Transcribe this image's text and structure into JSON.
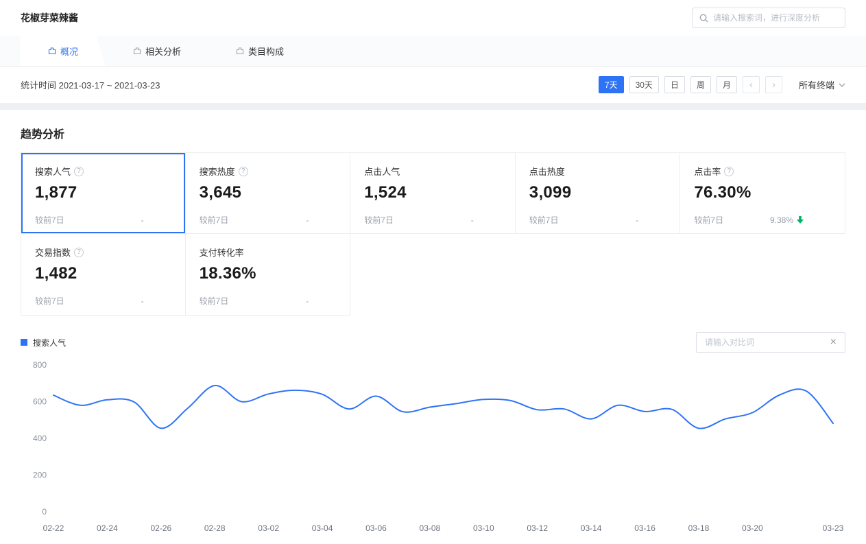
{
  "header": {
    "title": "花椒芽菜辣酱",
    "search": {
      "placeholder": "请输入搜索词，进行深度分析"
    }
  },
  "tabs": [
    {
      "id": "overview",
      "label": "概况",
      "active": true
    },
    {
      "id": "related-analysis",
      "label": "相关分析",
      "active": false
    },
    {
      "id": "category-composition",
      "label": "类目构成",
      "active": false
    }
  ],
  "filter_bar": {
    "stat_time": "统计时间 2021-03-17 ~ 2021-03-23",
    "range_buttons": [
      {
        "id": "7d",
        "label": "7天",
        "active": true
      },
      {
        "id": "30d",
        "label": "30天",
        "active": false
      },
      {
        "id": "day",
        "label": "日",
        "active": false
      },
      {
        "id": "week",
        "label": "周",
        "active": false
      },
      {
        "id": "month",
        "label": "月",
        "active": false
      }
    ],
    "terminal": "所有终端"
  },
  "trend_section": {
    "title": "趋势分析",
    "metrics": [
      {
        "id": "search-popularity",
        "label": "搜索人气",
        "info": true,
        "value": "1,877",
        "compare_label": "较前7日",
        "compare_value": "-",
        "selected": true,
        "trend": null
      },
      {
        "id": "search-heat",
        "label": "搜索热度",
        "info": true,
        "value": "3,645",
        "compare_label": "较前7日",
        "compare_value": "-",
        "selected": false,
        "trend": null
      },
      {
        "id": "click-popularity",
        "label": "点击人气",
        "info": false,
        "value": "1,524",
        "compare_label": "较前7日",
        "compare_value": "-",
        "selected": false,
        "trend": null
      },
      {
        "id": "click-heat",
        "label": "点击热度",
        "info": false,
        "value": "3,099",
        "compare_label": "较前7日",
        "compare_value": "-",
        "selected": false,
        "trend": null
      },
      {
        "id": "click-rate",
        "label": "点击率",
        "info": true,
        "value": "76.30%",
        "compare_label": "较前7日",
        "compare_value": "9.38%",
        "selected": false,
        "trend": "down"
      },
      {
        "id": "transaction-index",
        "label": "交易指数",
        "info": true,
        "value": "1,482",
        "compare_label": "较前7日",
        "compare_value": "-",
        "selected": false,
        "trend": null
      },
      {
        "id": "pay-conversion",
        "label": "支付转化率",
        "info": false,
        "value": "18.36%",
        "compare_label": "较前7日",
        "compare_value": "-",
        "selected": false,
        "trend": null
      }
    ],
    "legend": {
      "name": "搜索人气",
      "color": "#2e73f6"
    },
    "compare_input": {
      "placeholder": "请输入对比词"
    }
  },
  "chart_data": {
    "type": "line",
    "series": [
      {
        "name": "搜索人气",
        "color": "#2e73f6",
        "values": [
          635,
          580,
          610,
          598,
          455,
          565,
          688,
          600,
          642,
          662,
          640,
          560,
          630,
          545,
          570,
          590,
          612,
          606,
          556,
          560,
          506,
          580,
          546,
          558,
          455,
          506,
          540,
          636,
          658,
          482
        ]
      }
    ],
    "x": [
      "02-22",
      "02-23",
      "02-24",
      "02-25",
      "02-26",
      "02-27",
      "02-28",
      "03-01",
      "03-02",
      "03-03",
      "03-04",
      "03-05",
      "03-06",
      "03-07",
      "03-08",
      "03-09",
      "03-10",
      "03-11",
      "03-12",
      "03-13",
      "03-14",
      "03-15",
      "03-16",
      "03-17",
      "03-18",
      "03-19",
      "03-20",
      "03-21",
      "03-22",
      "03-23"
    ],
    "xtick_labels": [
      "02-22",
      "02-24",
      "02-26",
      "02-28",
      "03-02",
      "03-04",
      "03-06",
      "03-08",
      "03-10",
      "03-12",
      "03-14",
      "03-16",
      "03-18",
      "03-20",
      "03-23"
    ],
    "yticks": [
      0,
      200,
      400,
      600,
      800
    ],
    "ylim": [
      0,
      800
    ],
    "grid": false,
    "legend_position": "top-left"
  },
  "icons": {
    "info": "?",
    "chevron_left": "‹",
    "chevron_right": "›",
    "close": "×"
  },
  "colors": {
    "primary": "#2e73f6",
    "down_green": "#00b26a"
  }
}
